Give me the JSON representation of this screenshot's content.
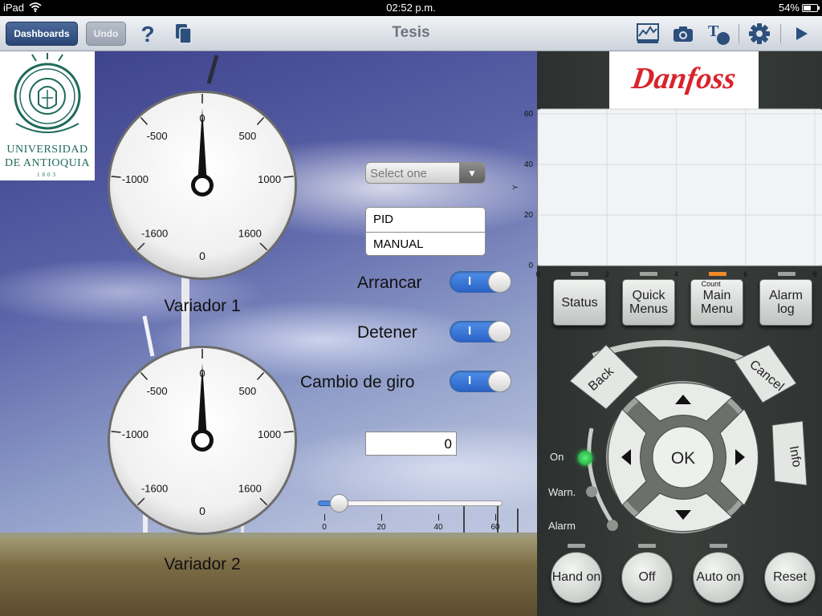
{
  "status_bar": {
    "device": "iPad",
    "time": "02:52 p.m.",
    "battery": "54%"
  },
  "toolbar": {
    "dashboards_label": "Dashboards",
    "undo_label": "Undo",
    "title": "Tesis",
    "icons": [
      "help-icon",
      "pages-icon",
      "chart-icon",
      "camera-icon",
      "text-style-icon",
      "gear-icon",
      "play-icon"
    ]
  },
  "logo": {
    "line1": "UNIVERSIDAD",
    "line2": "DE ANTIOQUIA",
    "year": "1803"
  },
  "gauges": [
    {
      "title": "Variador 1",
      "value": 0,
      "min_label": "-1600",
      "max_label": "1600",
      "bottom_label": "0",
      "ticks": [
        "-1000",
        "-500",
        "0",
        "500",
        "1000"
      ]
    },
    {
      "title": "Variador 2",
      "value": 0,
      "min_label": "-1600",
      "max_label": "1600",
      "bottom_label": "0",
      "ticks": [
        "-1000",
        "-500",
        "0",
        "500",
        "1000"
      ]
    }
  ],
  "select": {
    "placeholder": "Select one"
  },
  "mode_list": {
    "items": [
      "PID",
      "MANUAL"
    ]
  },
  "switches": [
    {
      "label": "Arrancar",
      "on_text": "I",
      "state": "on"
    },
    {
      "label": "Detener",
      "on_text": "I",
      "state": "on"
    },
    {
      "label": "Cambio de giro",
      "on_text": "I",
      "state": "on"
    }
  ],
  "numeric_field": {
    "value": "0"
  },
  "slider": {
    "value": 5,
    "min": 0,
    "max": 60,
    "tick_labels": [
      "0",
      "20",
      "40",
      "60"
    ]
  },
  "brand": {
    "name": "Danfoss"
  },
  "chart_data": {
    "type": "line",
    "title": "",
    "xlabel": "Count",
    "ylabel": "Y",
    "xlim": [
      0,
      8
    ],
    "ylim": [
      0,
      60
    ],
    "x_ticks": [
      "0",
      "2",
      "4",
      "6",
      "8"
    ],
    "y_ticks": [
      "0",
      "20",
      "40",
      "60"
    ],
    "series": [],
    "grid": true
  },
  "keypad": {
    "menu_buttons": [
      "Status",
      "Quick Menus",
      "Main Menu",
      "Alarm log"
    ],
    "back": "Back",
    "cancel": "Cancel",
    "info": "Info",
    "ok": "OK",
    "indicators": [
      "On",
      "Warn.",
      "Alarm"
    ],
    "bottom_buttons": [
      "Hand on",
      "Off",
      "Auto on",
      "Reset"
    ]
  }
}
